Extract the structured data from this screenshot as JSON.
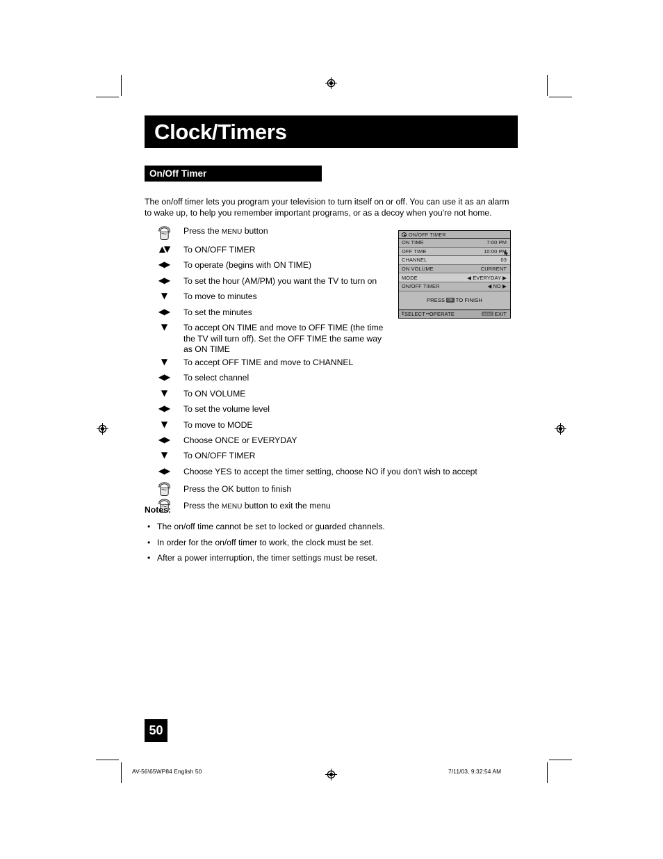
{
  "page": {
    "chapter_title": "Clock/Timers",
    "section_title": "On/Off Timer",
    "intro": "The on/off timer lets you program your television to turn itself on or off. You can use it as an alarm to wake up, to help you remember important programs, or as a decoy when you're not home.",
    "page_number": "50"
  },
  "steps": [
    {
      "icon": "hand-press-icon",
      "icon_glyph": "hand",
      "text_pre": "Press the ",
      "smallcaps": "Menu",
      "text_post": " button"
    },
    {
      "icon": "up-down-arrow-icon",
      "icon_glyph": "▲▼",
      "text": "To ON/OFF TIMER"
    },
    {
      "icon": "left-right-arrow-icon",
      "icon_glyph": "◀▶",
      "text": "To operate (begins with ON TIME)"
    },
    {
      "icon": "left-right-arrow-icon",
      "icon_glyph": "◀▶",
      "text": "To set the hour (AM/PM) you want the TV to turn on"
    },
    {
      "icon": "down-arrow-icon",
      "icon_glyph": "▼",
      "text": "To move to minutes"
    },
    {
      "icon": "left-right-arrow-icon",
      "icon_glyph": "◀▶",
      "text": "To set the minutes"
    },
    {
      "icon": "down-arrow-icon",
      "icon_glyph": "▼",
      "text": "To accept ON TIME and move to OFF TIME (the time the TV will turn off). Set the OFF TIME the same way as ON TIME"
    },
    {
      "icon": "down-arrow-icon",
      "icon_glyph": "▼",
      "text": "To accept OFF TIME and move to CHANNEL"
    },
    {
      "icon": "left-right-arrow-icon",
      "icon_glyph": "◀▶",
      "text": "To select channel"
    },
    {
      "icon": "down-arrow-icon",
      "icon_glyph": "▼",
      "text": "To ON VOLUME"
    },
    {
      "icon": "left-right-arrow-icon",
      "icon_glyph": "◀▶",
      "text": "To set the volume level"
    },
    {
      "icon": "down-arrow-icon",
      "icon_glyph": "▼",
      "text": "To move to MODE"
    },
    {
      "icon": "left-right-arrow-icon",
      "icon_glyph": "◀▶",
      "text": "Choose ONCE or EVERYDAY"
    },
    {
      "icon": "down-arrow-icon",
      "icon_glyph": "▼",
      "text": "To ON/OFF TIMER"
    },
    {
      "icon": "left-right-arrow-icon",
      "icon_glyph": "◀▶",
      "text": "Choose YES to accept the timer setting, choose NO if you don't wish to accept"
    },
    {
      "icon": "hand-press-icon",
      "icon_glyph": "hand",
      "text": "Press the OK button to finish"
    },
    {
      "icon": "hand-press-icon",
      "icon_glyph": "hand",
      "text_pre": "Press the ",
      "smallcaps": "Menu",
      "text_post": " button to exit the menu"
    }
  ],
  "notes": {
    "heading": "Notes:",
    "bullet": "•",
    "items": [
      "The on/off time cannot be set to locked or guarded channels.",
      "In order for the on/off timer to work, the clock must be set.",
      "After a power interruption, the timer settings must be reset."
    ]
  },
  "osd": {
    "header_title": "ON/OFF TIMER",
    "header_icon": "clock-icon",
    "rows": [
      {
        "label": "ON TIME",
        "value": "7:00 PM"
      },
      {
        "label": "OFF TIME",
        "value": "10:00 PM"
      },
      {
        "label": "CHANNEL",
        "value": "03"
      },
      {
        "label": "ON VOLUME",
        "value": "CURRENT"
      },
      {
        "label": "MODE",
        "value": "◀ EVERYDAY ▶"
      },
      {
        "label": "ON/OFF TIMER",
        "value": "◀ NO ▶"
      }
    ],
    "finish_pre": "PRESS",
    "finish_badge": "OK",
    "finish_post": "TO FINISH",
    "footer": {
      "select_glyph": "↕",
      "select_label": "SELECT",
      "operate_glyph": "↔",
      "operate_label": "OPERATE",
      "exit_badge": "MENU",
      "exit_label": "EXIT"
    }
  },
  "footer": {
    "file_info": "AV-56\\65WP84 English   50",
    "date_info": "7/11/03, 9:32:54 AM"
  }
}
